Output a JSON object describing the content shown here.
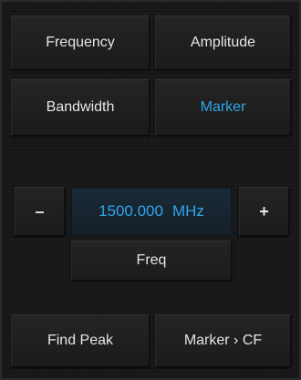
{
  "menu": {
    "frequency_label": "Frequency",
    "amplitude_label": "Amplitude",
    "bandwidth_label": "Bandwidth",
    "marker_label": "Marker",
    "active_item": "Marker"
  },
  "marker_control": {
    "decrement_label": "–",
    "increment_label": "+",
    "value": "1500.000",
    "unit": "MHz",
    "parameter_label": "Freq"
  },
  "actions": {
    "find_peak_label": "Find Peak",
    "marker_to_cf_label": "Marker › CF"
  },
  "colors": {
    "active_text": "#2fa6e9",
    "default_text": "#e6e6e6",
    "panel_background": "#161616"
  }
}
